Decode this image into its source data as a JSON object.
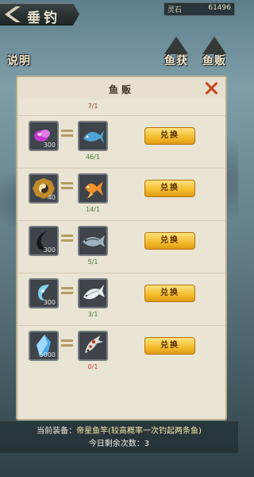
{
  "header": {
    "title": "垂钓",
    "currency_name": "灵石",
    "currency_value": "61496"
  },
  "side_buttons": {
    "left": "说明",
    "right_a": "鱼获",
    "right_b": "鱼贩"
  },
  "panel": {
    "title": "鱼贩",
    "partial_count": "7/1"
  },
  "exchanges": [
    {
      "input_icon": "purple-gem-icon",
      "input_qty": "300",
      "output_icon": "blue-fish-icon",
      "count": "46/1",
      "button": "兑换"
    },
    {
      "input_icon": "bagua-coin-icon",
      "input_qty": "40",
      "output_icon": "goldfish-icon",
      "count": "14/1",
      "button": "兑换"
    },
    {
      "input_icon": "black-claw-icon",
      "input_qty": "300",
      "output_icon": "silver-fish-icon",
      "count": "5/1",
      "button": "兑换"
    },
    {
      "input_icon": "azure-swirl-icon",
      "input_qty": "300",
      "output_icon": "white-fish-icon",
      "count": "3/1",
      "button": "兑换"
    },
    {
      "input_icon": "blue-crystal-icon",
      "input_qty": "5000",
      "output_icon": "koi-fish-icon",
      "count": "0/1",
      "button": "兑换"
    }
  ],
  "footer": {
    "equip_label": "当前装备：",
    "equip_name": "帝星鱼竿(较高概率一次钓起两条鱼)",
    "remaining": "今日剩余次数：3"
  }
}
